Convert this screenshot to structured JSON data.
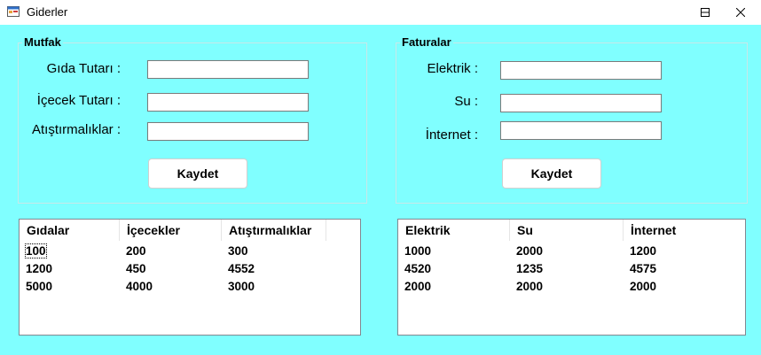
{
  "window": {
    "title": "Giderler"
  },
  "mutfak": {
    "group_title": "Mutfak",
    "labels": [
      "Gıda Tutarı :",
      "İçecek Tutarı :",
      "Atıştırmalıklar :"
    ],
    "inputs": [
      "",
      "",
      ""
    ],
    "save_label": "Kaydet",
    "list": {
      "columns": [
        "Gıdalar",
        "İçecekler",
        "Atıştırmalıklar"
      ],
      "rows": [
        [
          "100",
          "200",
          "300"
        ],
        [
          "1200",
          "450",
          "4552"
        ],
        [
          "5000",
          "4000",
          "3000"
        ]
      ]
    }
  },
  "faturalar": {
    "group_title": "Faturalar",
    "labels": [
      "Elektrik :",
      "Su :",
      "İnternet :"
    ],
    "inputs": [
      "",
      "",
      ""
    ],
    "save_label": "Kaydet",
    "list": {
      "columns": [
        "Elektrik",
        "Su",
        "İnternet"
      ],
      "rows": [
        [
          "1000",
          "2000",
          "1200"
        ],
        [
          "4520",
          "1235",
          "4575"
        ],
        [
          "2000",
          "2000",
          "2000"
        ]
      ]
    }
  },
  "colors": {
    "client_bg": "#80ffff",
    "window_bg": "#ffffff"
  },
  "icons": {
    "app": "app-form-icon",
    "minimize": "minimize-icon",
    "maximize": "maximize-icon",
    "close": "close-icon"
  }
}
